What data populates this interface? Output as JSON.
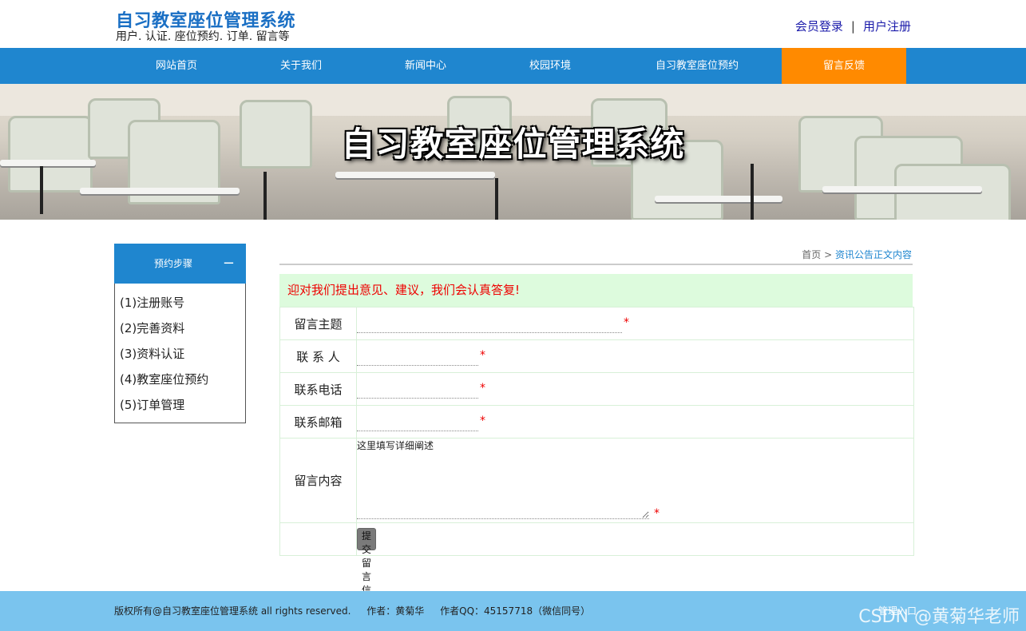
{
  "header": {
    "title": "自习教室座位管理系统",
    "subtitle": "用户. 认证. 座位预约. 订单. 留言等",
    "login": "会员登录",
    "separator": "|",
    "register": "用户注册"
  },
  "nav": {
    "items": [
      "网站首页",
      "关于我们",
      "新闻中心",
      "校园环境",
      "自习教室座位预约",
      "留言反馈"
    ],
    "active_index": 5
  },
  "banner": {
    "title": "自习教室座位管理系统"
  },
  "sidebar": {
    "title": "预约步骤",
    "collapse_icon": "−",
    "items": [
      "(1)注册账号",
      "(2)完善资料",
      "(3)资料认证",
      "(4)教室座位预约",
      "(5)订单管理"
    ]
  },
  "breadcrumb": {
    "home": "首页",
    "sep": ">",
    "current": "资讯公告正文内容"
  },
  "form": {
    "notice": "迎对我们提出意见、建议，我们会认真答复!",
    "subject_label": "留言主题",
    "contact_label": "联 系 人",
    "phone_label": "联系电话",
    "email_label": "联系邮箱",
    "content_label": "留言内容",
    "content_value": "这里填写详细阐述",
    "required_mark": "*",
    "submit_label": "提交留言信息"
  },
  "footer": {
    "copyright": "版权所有@自习教室座位管理系统 all rights reserved.",
    "author": "作者：黄菊华",
    "qq": "作者QQ：45157718（微信同号）",
    "right_text": "管理入口"
  },
  "watermark": "CSDN @黄菊华老师",
  "colors": {
    "nav": "#1f86cf",
    "nav_active": "#ff8a00",
    "notice_bg": "#ddfbdd",
    "footer": "#7ac4ee",
    "title": "#1a6fc4"
  }
}
